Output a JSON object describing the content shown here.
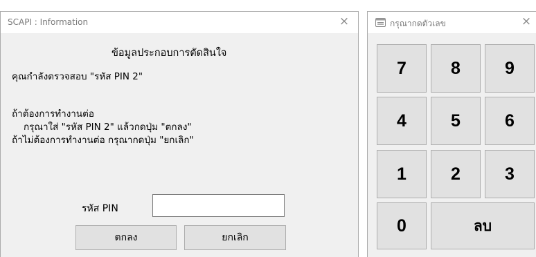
{
  "info_window": {
    "title": "SCAPI : Information",
    "close_label": "×",
    "heading": "ข้อมูลประกอบการตัดสินใจ",
    "message_lines": [
      "คุณกำลังตรวจสอบ \"รหัส PIN 2\"",
      "ถ้าต้องการทำงานต่อ",
      "กรุณาใส่ \"รหัส PIN 2\" แล้วกดปุ่ม \"ตกลง\"",
      "ถ้าไม่ต้องการทำงานต่อ กรุณากดปุ่ม \"ยกเลิก\""
    ],
    "pin_label": "รหัส PIN",
    "pin_value": "",
    "ok_label": "ตกลง",
    "cancel_label": "ยกเลิก"
  },
  "keypad_window": {
    "title": "กรุณากดตัวเลข",
    "close_label": "×",
    "icon": "keyboard-icon",
    "keys": [
      "7",
      "8",
      "9",
      "4",
      "5",
      "6",
      "1",
      "2",
      "3",
      "0"
    ],
    "delete_label": "ลบ"
  },
  "colors": {
    "window_bg": "#f0f0f0",
    "titlebar_bg": "#ffffff",
    "button_bg": "#e1e1e1",
    "button_border": "#adadad",
    "title_text": "#7a7a7a"
  }
}
